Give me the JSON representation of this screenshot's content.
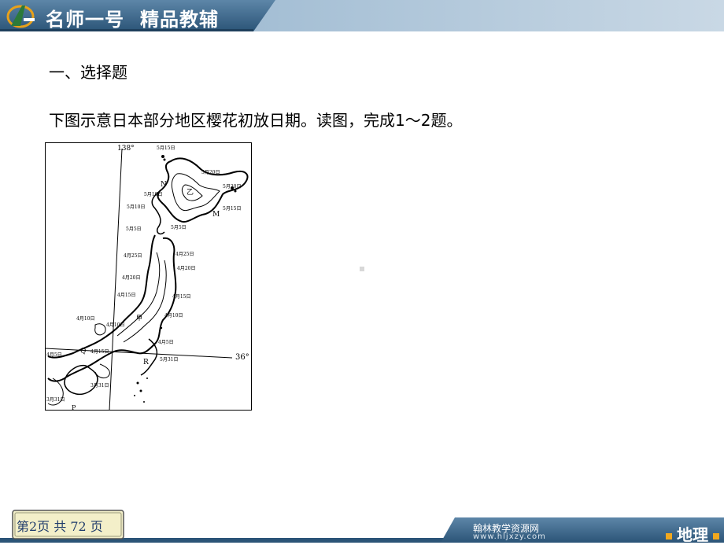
{
  "header": {
    "brand": "名师一号",
    "slogan": "精品教辅",
    "colors": {
      "banner_dark": "#274f6e",
      "banner_light": "#7da3c2",
      "accent": "#e8a11a"
    }
  },
  "content": {
    "section_title": "一、选择题",
    "question_text": "下图示意日本部分地区樱花初放日期。读图，完成1～2题。"
  },
  "map": {
    "longitude_label": "138°",
    "latitude_label": "36°",
    "point_labels": [
      "N",
      "乙",
      "M",
      "甲",
      "Q",
      "R",
      "P"
    ],
    "date_labels": [
      "5月15日",
      "5月20日",
      "5月20日",
      "5月10日",
      "5月15日",
      "5月10日",
      "5月5日",
      "5月5日",
      "4月25日",
      "4月25日",
      "4月20日",
      "4月20日",
      "4月15日",
      "4月15日",
      "4月10日",
      "4月10日",
      "4月10日",
      "4月5日",
      "4月5日",
      "4月15日",
      "5月31日",
      "3月31日",
      "3月31日"
    ]
  },
  "footer": {
    "page_info": "第2页  共  72  页",
    "site_name": "翰林教学资源网",
    "site_url": "www.hljxzy.com",
    "subject": "地理"
  }
}
